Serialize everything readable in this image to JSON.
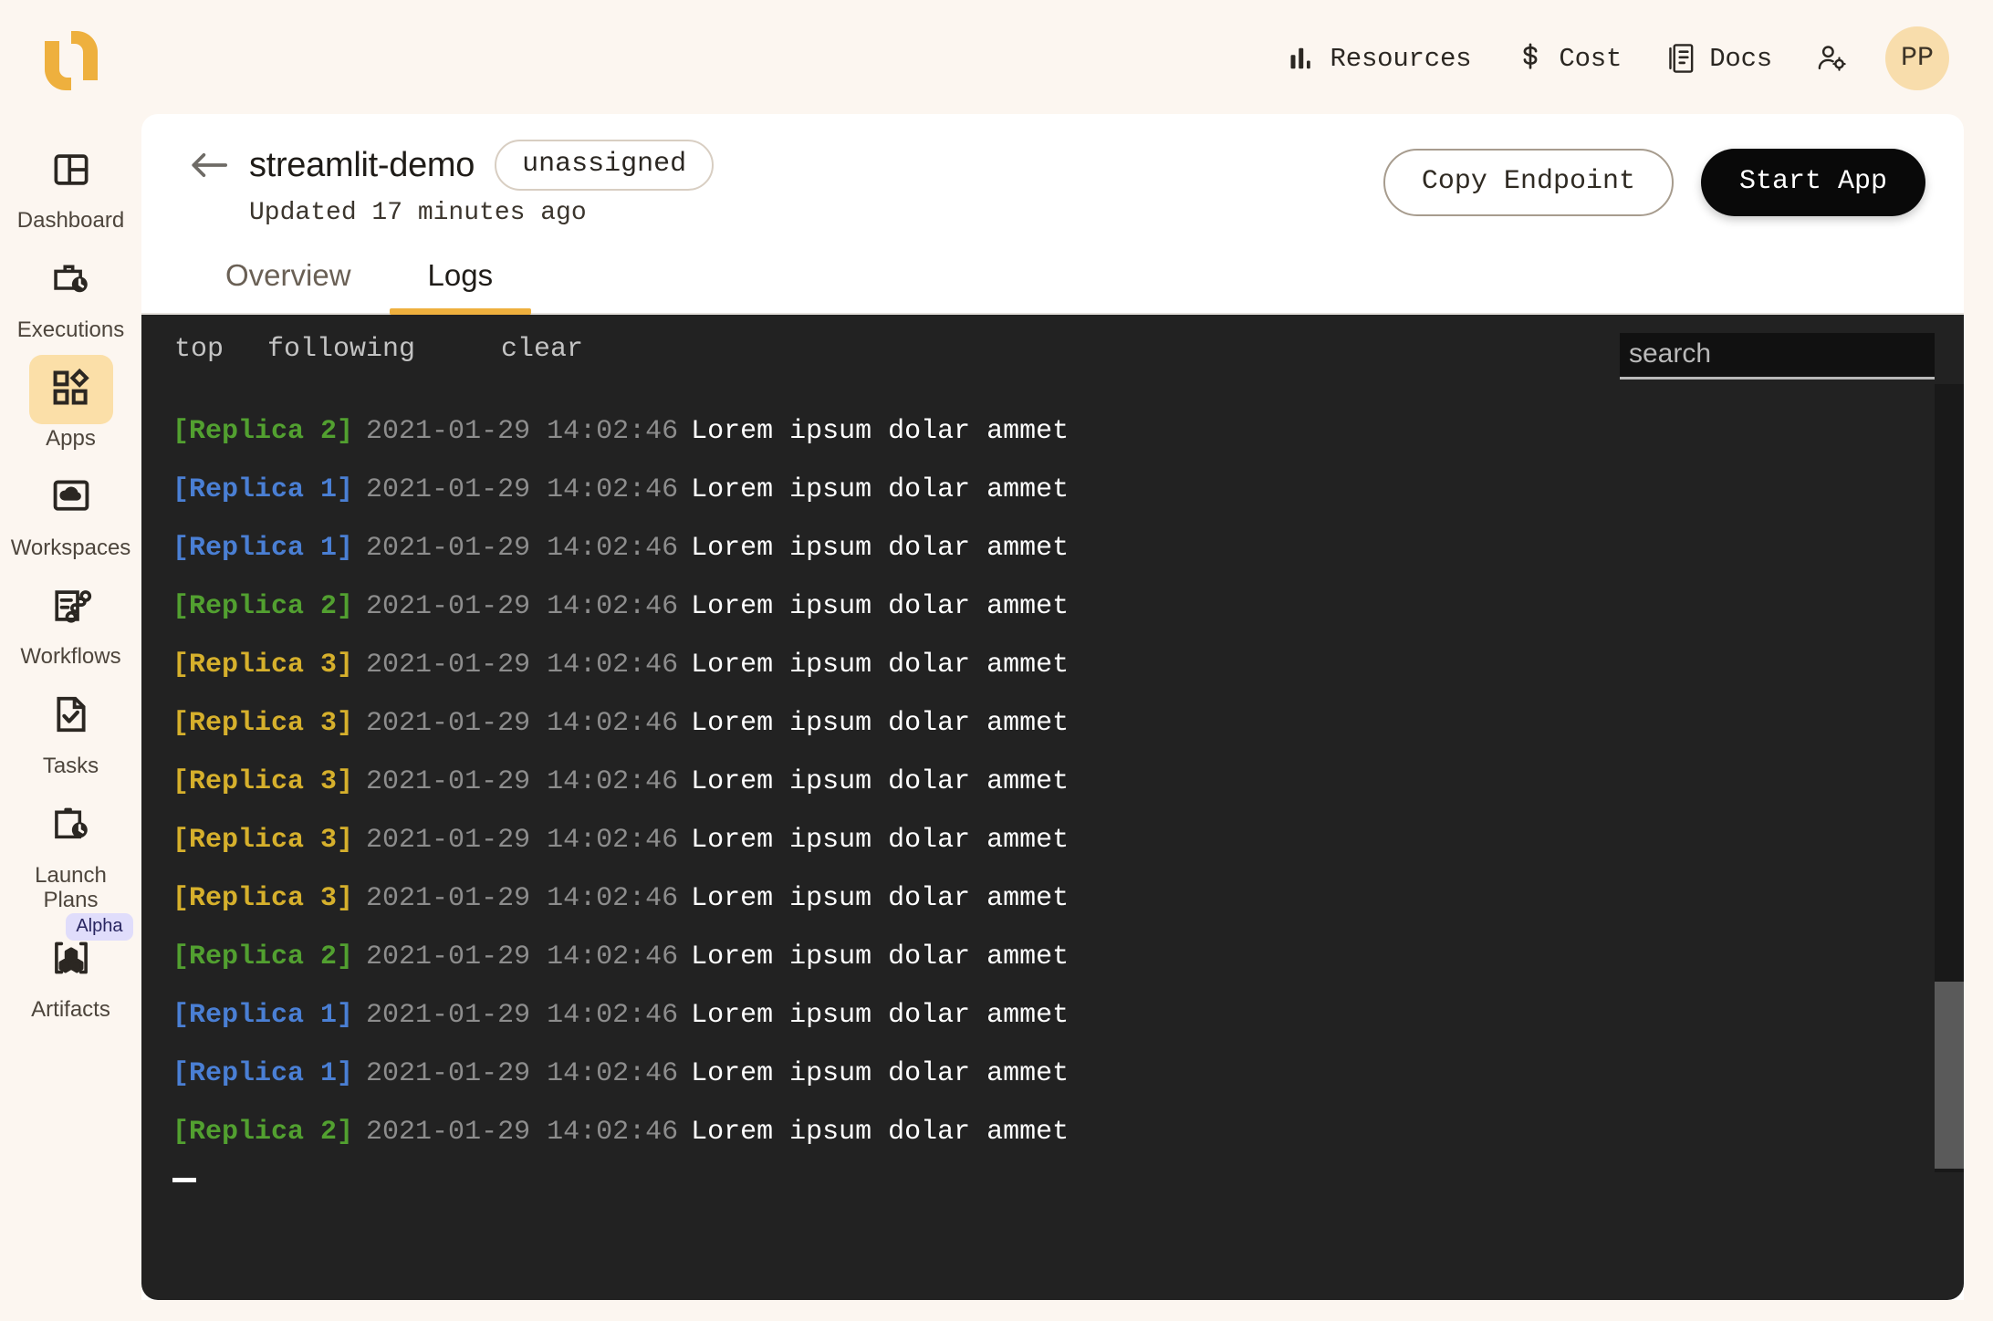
{
  "brand": {
    "logo_name": "union-logo",
    "accent": "#eeb03e"
  },
  "topnav": {
    "items": [
      {
        "label": "Resources",
        "icon": "bar-chart-icon"
      },
      {
        "label": "Cost",
        "icon": "dollar-icon"
      },
      {
        "label": "Docs",
        "icon": "docs-icon"
      }
    ],
    "user_settings_icon": "user-settings-icon",
    "avatar_initials": "PP"
  },
  "sidebar": {
    "items": [
      {
        "label": "Dashboard",
        "icon": "dashboard-icon",
        "active": false,
        "badge": null
      },
      {
        "label": "Executions",
        "icon": "executions-icon",
        "active": false,
        "badge": null
      },
      {
        "label": "Apps",
        "icon": "apps-icon",
        "active": true,
        "badge": null
      },
      {
        "label": "Workspaces",
        "icon": "workspaces-icon",
        "active": false,
        "badge": null
      },
      {
        "label": "Workflows",
        "icon": "workflows-icon",
        "active": false,
        "badge": null
      },
      {
        "label": "Tasks",
        "icon": "tasks-icon",
        "active": false,
        "badge": null
      },
      {
        "label": "Launch\nPlans",
        "icon": "launch-plans-icon",
        "active": false,
        "badge": null
      },
      {
        "label": "Artifacts",
        "icon": "artifacts-icon",
        "active": false,
        "badge": "Alpha"
      }
    ]
  },
  "header": {
    "back_label": "back",
    "app_name": "streamlit-demo",
    "status": "unassigned",
    "updated": "Updated 17 minutes ago",
    "copy_endpoint_label": "Copy Endpoint",
    "start_app_label": "Start App"
  },
  "tabs": [
    {
      "label": "Overview",
      "active": false
    },
    {
      "label": "Logs",
      "active": true
    }
  ],
  "terminal": {
    "toolbar": {
      "top_label": "top",
      "following_label": "following",
      "clear_label": "clear"
    },
    "search_placeholder": "search",
    "search_value": "",
    "colors": {
      "replica_1": "#4a7fd4",
      "replica_2": "#52a030",
      "replica_3": "#d6b02c",
      "timestamp": "#8d8d8d",
      "message": "#ffffff",
      "background": "#222222"
    },
    "lines": [
      {
        "replica": "[Replica 2]",
        "n": 2,
        "timestamp": "2021-01-29 14:02:46",
        "message": "Lorem ipsum dolar ammet"
      },
      {
        "replica": "[Replica 1]",
        "n": 1,
        "timestamp": "2021-01-29 14:02:46",
        "message": "Lorem ipsum dolar ammet"
      },
      {
        "replica": "[Replica 1]",
        "n": 1,
        "timestamp": "2021-01-29 14:02:46",
        "message": "Lorem ipsum dolar ammet"
      },
      {
        "replica": "[Replica 2]",
        "n": 2,
        "timestamp": "2021-01-29 14:02:46",
        "message": "Lorem ipsum dolar ammet"
      },
      {
        "replica": "[Replica 3]",
        "n": 3,
        "timestamp": "2021-01-29 14:02:46",
        "message": "Lorem ipsum dolar ammet"
      },
      {
        "replica": "[Replica 3]",
        "n": 3,
        "timestamp": "2021-01-29 14:02:46",
        "message": "Lorem ipsum dolar ammet"
      },
      {
        "replica": "[Replica 3]",
        "n": 3,
        "timestamp": "2021-01-29 14:02:46",
        "message": "Lorem ipsum dolar ammet"
      },
      {
        "replica": "[Replica 3]",
        "n": 3,
        "timestamp": "2021-01-29 14:02:46",
        "message": "Lorem ipsum dolar ammet"
      },
      {
        "replica": "[Replica 3]",
        "n": 3,
        "timestamp": "2021-01-29 14:02:46",
        "message": "Lorem ipsum dolar ammet"
      },
      {
        "replica": "[Replica 2]",
        "n": 2,
        "timestamp": "2021-01-29 14:02:46",
        "message": "Lorem ipsum dolar ammet"
      },
      {
        "replica": "[Replica 1]",
        "n": 1,
        "timestamp": "2021-01-29 14:02:46",
        "message": "Lorem ipsum dolar ammet"
      },
      {
        "replica": "[Replica 1]",
        "n": 1,
        "timestamp": "2021-01-29 14:02:46",
        "message": "Lorem ipsum dolar ammet"
      },
      {
        "replica": "[Replica 2]",
        "n": 2,
        "timestamp": "2021-01-29 14:02:46",
        "message": "Lorem ipsum dolar ammet"
      }
    ]
  }
}
